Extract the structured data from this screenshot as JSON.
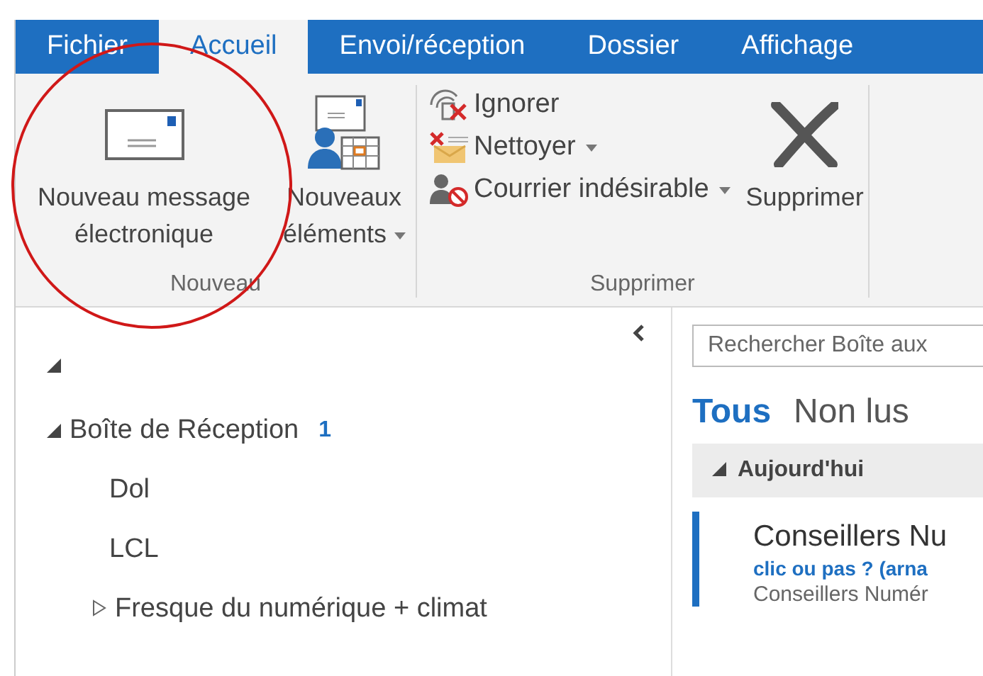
{
  "tabs": [
    {
      "label": "Fichier",
      "selected": false
    },
    {
      "label": "Accueil",
      "selected": true
    },
    {
      "label": "Envoi/réception",
      "selected": false
    },
    {
      "label": "Dossier",
      "selected": false
    },
    {
      "label": "Affichage",
      "selected": false
    }
  ],
  "ribbon": {
    "groups": [
      {
        "label": "Nouveau",
        "items": [
          {
            "kind": "large",
            "label": "Nouveau message électronique",
            "dropdown": false
          },
          {
            "kind": "large",
            "label": "Nouveaux éléments",
            "dropdown": true
          }
        ]
      },
      {
        "label": "Supprimer",
        "items": [
          {
            "kind": "small",
            "label": "Ignorer",
            "dropdown": false
          },
          {
            "kind": "small",
            "label": "Nettoyer",
            "dropdown": true
          },
          {
            "kind": "small",
            "label": "Courrier indésirable",
            "dropdown": true
          },
          {
            "kind": "large",
            "label": "Supprimer",
            "dropdown": false
          }
        ]
      }
    ]
  },
  "folder_pane": {
    "account": {
      "expanded": true,
      "folders": [
        {
          "name": "Boîte de Réception",
          "count": "1",
          "expanded": true,
          "children": [
            {
              "name": "Dol"
            },
            {
              "name": "LCL"
            },
            {
              "name": "Fresque du numérique + climat",
              "expanded": false
            }
          ]
        }
      ]
    }
  },
  "message_list": {
    "search": {
      "placeholder": "Rechercher Boîte aux"
    },
    "filters": [
      {
        "label": "Tous",
        "selected": true
      },
      {
        "label": "Non lus",
        "selected": false
      }
    ],
    "group": {
      "label": "Aujourd'hui",
      "expanded": true
    },
    "messages": [
      {
        "sender": "Conseillers Nu",
        "subject": "clic ou pas ? (arna",
        "preview": "Conseillers Numér",
        "selected": true
      }
    ]
  }
}
